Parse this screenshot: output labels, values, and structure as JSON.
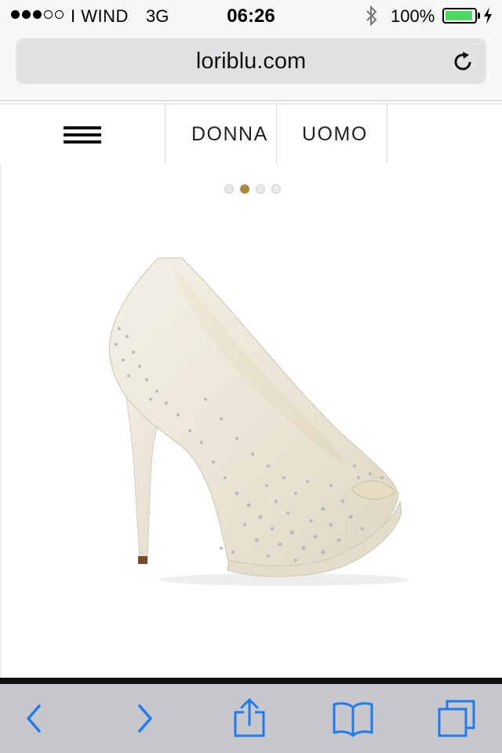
{
  "status_bar": {
    "carrier": "I WIND",
    "network": "3G",
    "time": "06:26",
    "battery_percent": "100%",
    "signal_bars_filled": 3,
    "signal_bars_total": 5
  },
  "browser": {
    "url": "loriblu.com"
  },
  "site_nav": {
    "links": [
      "DONNA",
      "UOMO"
    ]
  },
  "carousel": {
    "total_slides": 4,
    "active_slide": 2
  },
  "colors": {
    "accent_gold": "#a88a3c",
    "toolbar_blue": "#1e7cf2",
    "battery_green": "#4cd964"
  },
  "toolbar": {
    "icons": [
      "back-icon",
      "forward-icon",
      "share-icon",
      "bookmarks-icon",
      "tabs-icon"
    ]
  }
}
